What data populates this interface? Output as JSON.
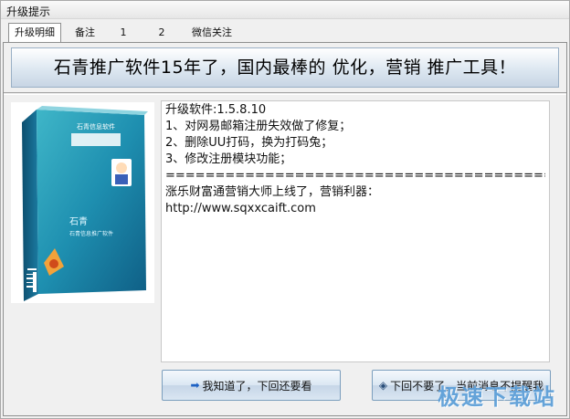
{
  "window": {
    "title": "升级提示"
  },
  "tabs": [
    {
      "label": "升级明细",
      "active": true
    },
    {
      "label": "备注",
      "active": false
    },
    {
      "label": "1",
      "active": false
    },
    {
      "label": "2",
      "active": false
    },
    {
      "label": "微信关注",
      "active": false
    }
  ],
  "banner": {
    "text": "石青推广软件15年了，国内最棒的 优化，营销 推广工具！"
  },
  "product": {
    "box_title": "石青信息软件",
    "box_name": "石青",
    "box_subtitle": "石青信息推广软件"
  },
  "message": {
    "lines": [
      "升级软件:1.5.8.10",
      "1、对网易邮箱注册失效做了修复；",
      "2、删除UU打码，换为打码兔；",
      "3、修改注册模块功能；",
      "================================================",
      "涨乐财富通营销大师上线了，营销利器：",
      "http://www.sqxxcaift.com"
    ]
  },
  "buttons": {
    "later": {
      "label": "我知道了，下回还要看",
      "icon": "arrow-right-icon"
    },
    "never": {
      "label": "下回不要了，当前消息不提醒我",
      "icon": "diamond-icon"
    }
  },
  "watermark": {
    "text": "极速下载站"
  },
  "colors": {
    "button_border": "#7b9ebd",
    "arrow_icon": "#1e62c4",
    "watermark": "#5b9ed8"
  }
}
